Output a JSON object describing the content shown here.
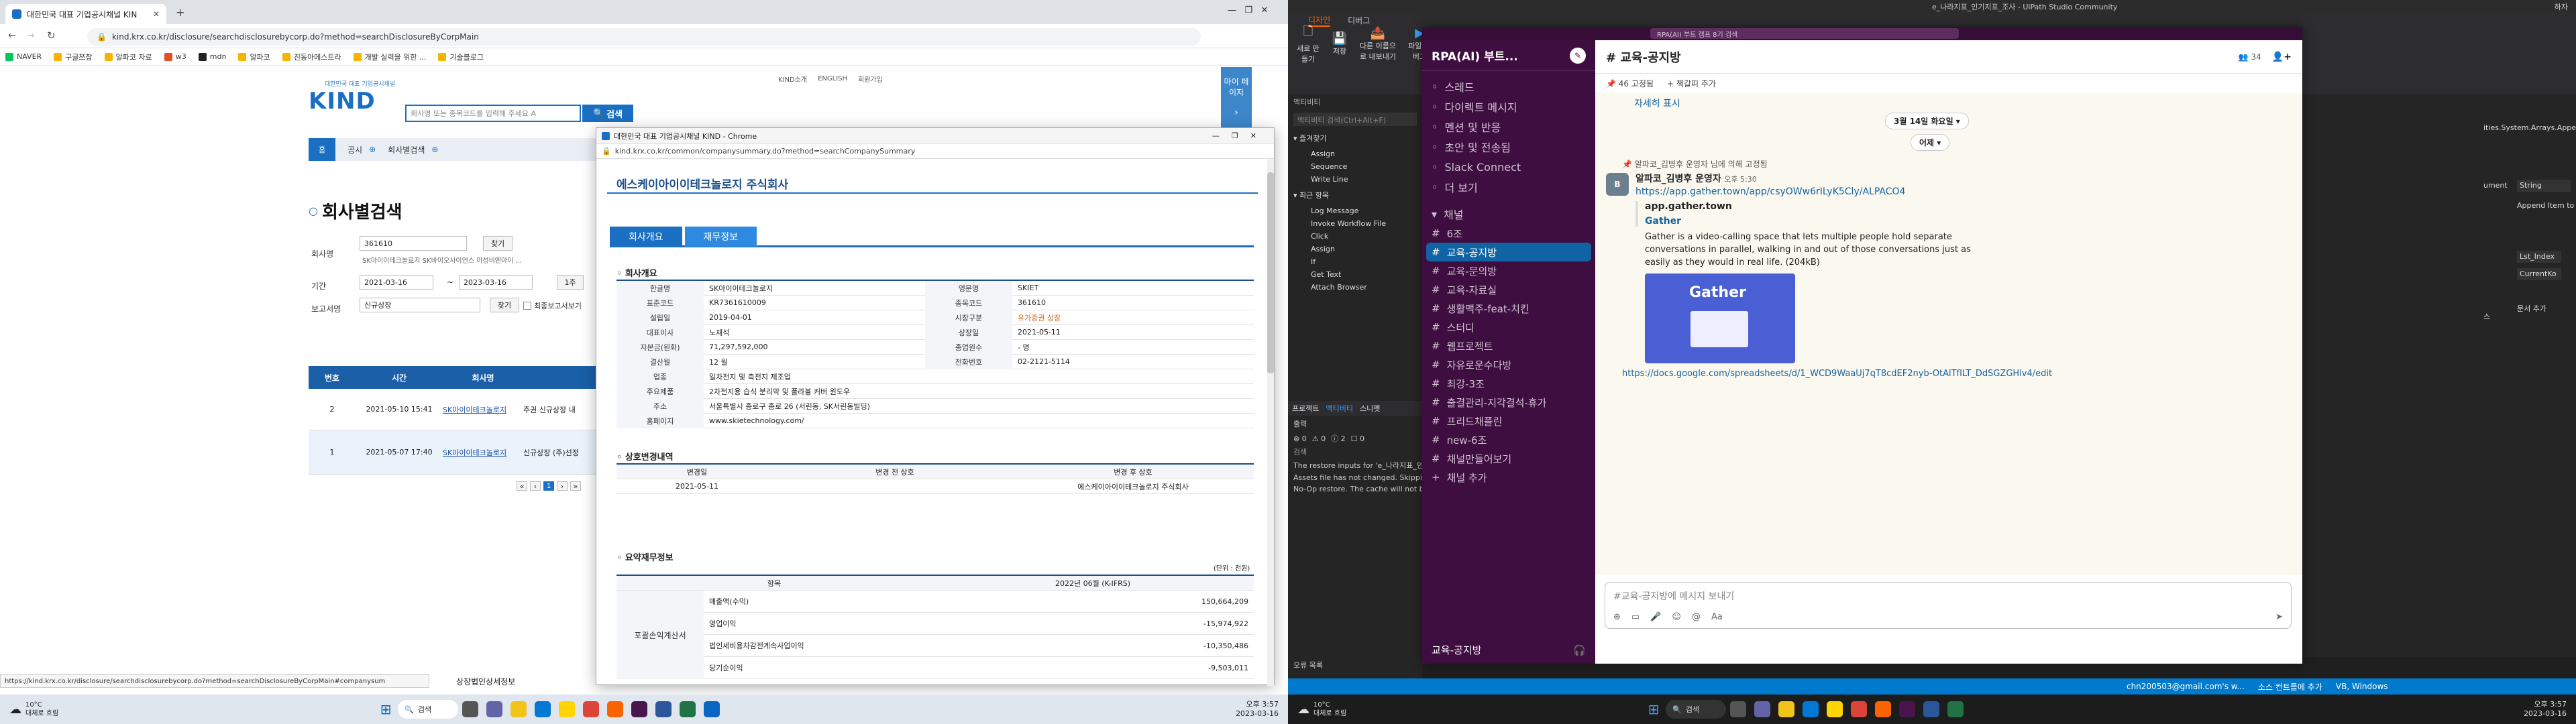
{
  "left": {
    "tab_title": "대한민국 대표 기업공시채널 KIN",
    "url": "kind.krx.co.kr/disclosure/searchdisclosurebycorp.do?method=searchDisclosureByCorpMain",
    "bookmarks": [
      "NAVER",
      "구글쯔찹",
      "알파코 자료",
      "w3",
      "mdn",
      "알파코",
      "진동아에스트라",
      "개발 실력을 위한 ...",
      "기술블로그"
    ],
    "logo_text": "KIND",
    "logo_sub": "대한민국 대표 기업공시채널",
    "top_links": [
      "KIND소개",
      "ENGLISH",
      "회원가입"
    ],
    "search_placeholder": "회사명 또는 종목코드를 입력해 주세요 A",
    "search_button": "검색",
    "side_panel": "마이 페이지",
    "nav": {
      "home": "홈",
      "c1": "공시",
      "c2": "회사별검색"
    },
    "page_title": "회사별검색",
    "form": {
      "company_label": "회사명",
      "company_value": "361610",
      "find_btn": "찾기",
      "hint": "SK아이이테크놀로지 SK바이오사이언스 이성비엔아이 ...",
      "period_label": "기간",
      "date_from": "2021-03-16",
      "date_to": "2023-03-16",
      "range_btn": "1주",
      "report_label": "보고서명",
      "report_value": "신규상장",
      "find_btn2": "찾기",
      "final_report": "최종보고서보기"
    },
    "table_headers": [
      "번호",
      "시간",
      "회사명"
    ],
    "rows": [
      {
        "no": "2",
        "time": "2021-05-10 15:41",
        "company": "SK아이이테크놀로지",
        "title": "주권 신규상장 내"
      },
      {
        "no": "1",
        "time": "2021-05-07 17:40",
        "company": "SK아이이테크놀로지",
        "title": "신규상장 (주)선정"
      }
    ],
    "rights_label": "상장법인상세정보",
    "status_url": "https://kind.krx.co.kr/disclosure/searchdisclosurebycorp.do?method=searchDisclosureByCorpMain#companysum",
    "popup": {
      "title": "대한민국 대표 기업공시채널 KIND - Chrome",
      "url": "kind.krx.co.kr/common/companysummary.do?method=searchCompanySummary",
      "company": "에스케이아이이테크놀로지 주식회사",
      "tabs": [
        "회사개요",
        "재무정보"
      ],
      "section1": "회사개요",
      "info": [
        [
          "한글명",
          "SK아이이테크놀로지",
          "영문명",
          "SKIET"
        ],
        [
          "표준코드",
          "KR7361610009",
          "종목코드",
          "361610"
        ],
        [
          "설립일",
          "2019-04-01",
          "시장구분",
          "유가증권 상장"
        ],
        [
          "대표이사",
          "노재석",
          "상장일",
          "2021-05-11"
        ],
        [
          "자본금(원화)",
          "71,297,592,000",
          "종업원수",
          "- 명"
        ],
        [
          "결산월",
          "12 월",
          "전화번호",
          "02-2121-5114"
        ],
        [
          "업종",
          "일차전지 및 축전지 제조업",
          "",
          ""
        ],
        [
          "주요제품",
          "2차전지용 습식 분리막 및 플라블 커버 윈도우",
          "",
          ""
        ],
        [
          "주소",
          "서울특별시 종로구 종로 26 (서린동, SK서린동빌딩)",
          "",
          ""
        ],
        [
          "홈페이지",
          "www.skietechnology.com/",
          "",
          ""
        ]
      ],
      "section2": "상호변경내역",
      "change_headers": [
        "변경일",
        "변경 전 상호",
        "변경 후 상호"
      ],
      "change_row": [
        "2021-05-11",
        "",
        "에스케이아이이테크놀로지 주식회사"
      ],
      "section3": "요약재무정보",
      "unit": "(단위 : 천원)",
      "fin_headers": [
        "항목",
        "2022년 06월 (K-IFRS)"
      ],
      "fin_group": "포괄손익계산서",
      "fin_rows": [
        [
          "매출액(수익)",
          "150,664,209"
        ],
        [
          "영업이익",
          "-15,974,922"
        ],
        [
          "법인세비용차감전계속사업이익",
          "-10,350,486"
        ],
        [
          "당기순이익",
          "-9,503,011"
        ]
      ]
    },
    "weather_temp": "10°C",
    "weather_desc": "대체로 흐림",
    "taskbar_search": "검색",
    "clock_time": "오후 3:57",
    "clock_date": "2023-03-16"
  },
  "right": {
    "window_title": "e_나라지표_인기지표_조사 - UiPath Studio Community",
    "ribbon_tabs": [
      "디자인",
      "디버그"
    ],
    "ribbon_buttons": [
      "새로 만들기",
      "저장",
      "다른 이름으로 내보내기",
      "파일 디버그"
    ],
    "activity_header": "액티비티",
    "activity_search": "액티비티 검색(Ctrl+Alt+F)",
    "fav_header": "즐겨찾기",
    "favs": [
      "Assign",
      "Sequence",
      "Write Line"
    ],
    "recent_header": "최근 항목",
    "recents": [
      "Log Message",
      "Invoke Workflow File",
      "Click",
      "Assign",
      "If",
      "Get Text",
      "Attach Browser"
    ],
    "bottom_tabs": [
      "프로젝트",
      "액티비티",
      "스니펫"
    ],
    "output_header": "출력",
    "output_counts": [
      "0",
      "0",
      "2",
      "0"
    ],
    "output_lines": [
      "The restore inputs for 'e_나라지표_인기지표_...",
      "Assets file has not changed. Skipping asset...",
      "No-Op restore. The cache will not be updat..."
    ],
    "output_label": "검색",
    "error_label": "오류 목록",
    "status_right": "chn200503@gmail.com's w...",
    "status_ctrl": "소스 컨트롤에 추가",
    "status_vb": "VB, Windows",
    "props": [
      "ities.System.Arrays.AppendItemToList...",
      "ument",
      "String",
      "Append Item to",
      "Lst_Index",
      "CurrentKo",
      "스",
      "문서 추가"
    ],
    "slack": {
      "workspace": "RPA(AI) 부트...",
      "banner": "RPA(AI) 부트 캠프 8기 검색",
      "nav": [
        "스레드",
        "다이렉트 메시지",
        "멘션 및 반응",
        "초안 및 전송됨",
        "Slack Connect",
        "더 보기"
      ],
      "channel_header": "채널",
      "channels": [
        "6조",
        "교육-공지방",
        "교육-문의방",
        "교육-자료실",
        "생활맥주-feat-치킨",
        "스터디",
        "웹프로젝트",
        "자유로운수다방",
        "최강-3조",
        "출결관리-지각결석-휴가",
        "프리드채플린",
        "new-6조",
        "채널만들어보기",
        "채널 추가"
      ],
      "active_channel": "교육-공지방",
      "footer": "교육-공지방",
      "ch_title": "# 교육-공지방",
      "pinned": "46 고정됨",
      "bookmark": "책갈피 추가",
      "show_more": "자세히 표시",
      "date_pill1": "3월 14일 화요일",
      "date_pill2": "어제",
      "pinned_by": "알파코_김병후 운영자 님에 의해 고정됨",
      "sender": "알파코_김병후 운영자",
      "time": "오후 5:30",
      "link": "https://app.gather.town/app/csyOWw6rILyK5Cly/ALPACO4",
      "site": "app.gather.town",
      "preview_title": "Gather",
      "preview_desc": "Gather is a video-calling space that lets multiple people hold separate conversations in parallel, walking in and out of those conversations just as easily as they would in real life. (204kB)",
      "gather_logo": "Gather",
      "link2": "https://docs.google.com/spreadsheets/d/1_WCD9WaaUj7qT8cdEF2nyb-OtAlTfILT_DdSGZGHlv4/edit",
      "composer": "#교육-공지방에 메시지 보내기",
      "member_count": "34",
      "header_channel": "# 교육-공지방"
    },
    "weather_temp": "10°C",
    "weather_desc": "대체로 흐림",
    "taskbar_search": "검색",
    "clock_time": "오후 3:57",
    "clock_date": "2023-03-16",
    "tray_lang": "하자"
  }
}
